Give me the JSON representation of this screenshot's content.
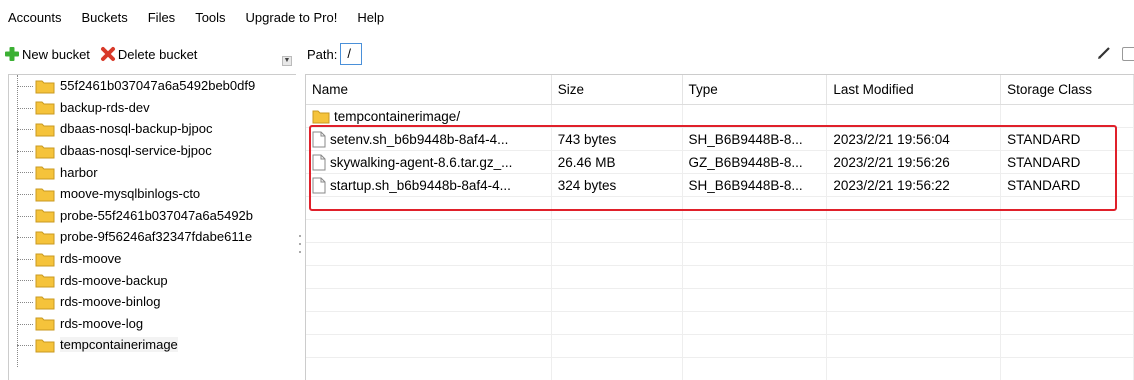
{
  "menu": {
    "accounts": "Accounts",
    "buckets": "Buckets",
    "files": "Files",
    "tools": "Tools",
    "upgrade": "Upgrade to Pro!",
    "help": "Help"
  },
  "toolbar": {
    "new_bucket": "New bucket",
    "delete_bucket": "Delete bucket"
  },
  "path": {
    "label": "Path:",
    "value": "/"
  },
  "buckets": [
    {
      "name": "55f2461b037047a6a5492beb0df9"
    },
    {
      "name": "backup-rds-dev"
    },
    {
      "name": "dbaas-nosql-backup-bjpoc"
    },
    {
      "name": "dbaas-nosql-service-bjpoc"
    },
    {
      "name": "harbor"
    },
    {
      "name": "moove-mysqlbinlogs-cto"
    },
    {
      "name": "probe-55f2461b037047a6a5492b"
    },
    {
      "name": "probe-9f56246af32347fdabe611e"
    },
    {
      "name": "rds-moove"
    },
    {
      "name": "rds-moove-backup"
    },
    {
      "name": "rds-moove-binlog"
    },
    {
      "name": "rds-moove-log"
    },
    {
      "name": "tempcontainerimage"
    }
  ],
  "columns": {
    "name": "Name",
    "size": "Size",
    "type": "Type",
    "modified": "Last Modified",
    "storage": "Storage Class"
  },
  "files": [
    {
      "kind": "folder",
      "name": "tempcontainerimage/",
      "size": "",
      "type": "",
      "modified": "",
      "storage": ""
    },
    {
      "kind": "file",
      "name": "setenv.sh_b6b9448b-8af4-4...",
      "size": "743 bytes",
      "type": "SH_B6B9448B-8...",
      "modified": "2023/2/21 19:56:04",
      "storage": "STANDARD"
    },
    {
      "kind": "file",
      "name": "skywalking-agent-8.6.tar.gz_...",
      "size": "26.46 MB",
      "type": "GZ_B6B9448B-8...",
      "modified": "2023/2/21 19:56:26",
      "storage": "STANDARD"
    },
    {
      "kind": "file",
      "name": "startup.sh_b6b9448b-8af4-4...",
      "size": "324 bytes",
      "type": "SH_B6B9448B-8...",
      "modified": "2023/2/21 19:56:22",
      "storage": "STANDARD"
    }
  ],
  "colors": {
    "highlight": "#e0202a",
    "folder": "#f5c33b",
    "add": "#3cb034",
    "delete": "#d83a2a"
  }
}
